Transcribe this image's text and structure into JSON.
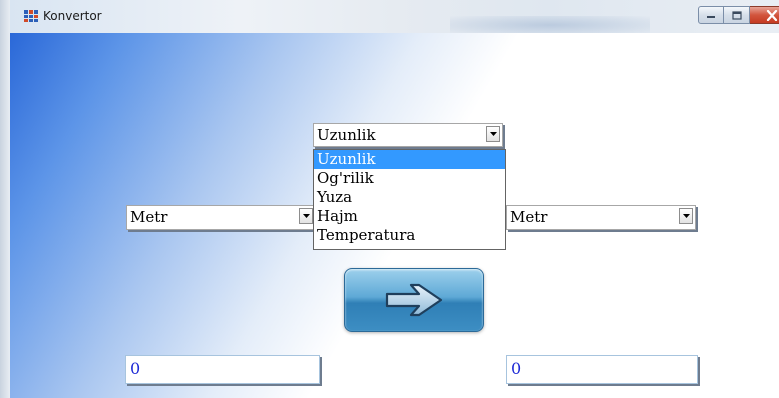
{
  "window": {
    "title": "Konvertor",
    "icons": {
      "app": "app-grid-icon",
      "minimize": "minimize-icon",
      "maximize": "maximize-icon",
      "close": "close-icon"
    }
  },
  "category_select": {
    "selected": "Uzunlik",
    "options": [
      "Uzunlik",
      "Og'rilik",
      "Yuza",
      "Hajm",
      "Temperatura"
    ],
    "highlighted": "Uzunlik"
  },
  "from_unit": {
    "selected": "Metr"
  },
  "to_unit": {
    "selected": "Metr"
  },
  "convert_button": {
    "icon": "right-arrow-icon"
  },
  "from_value": {
    "value": "0"
  },
  "to_value": {
    "value": "0"
  },
  "colors": {
    "accent": "#3399ff",
    "value_text": "#1f2bd6",
    "button": "#4f9bd0",
    "close": "#c53b22"
  }
}
